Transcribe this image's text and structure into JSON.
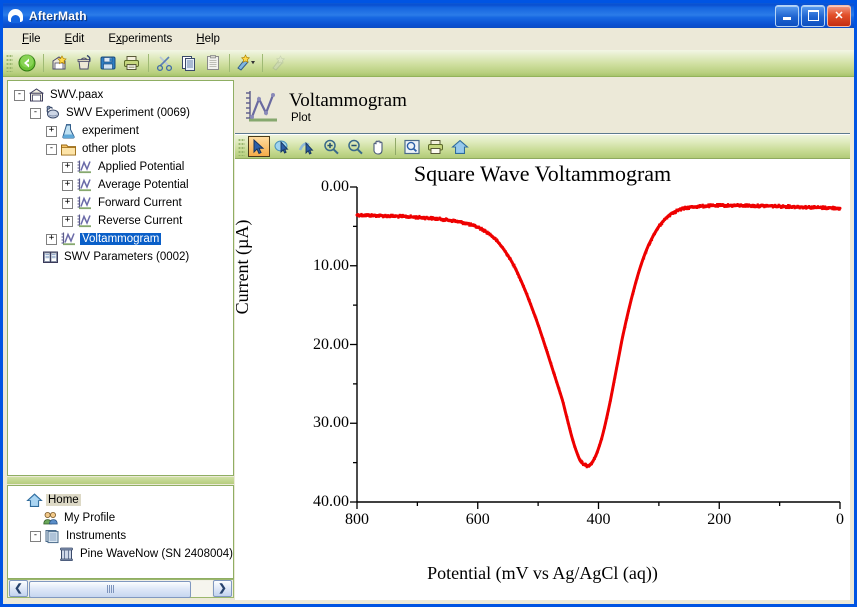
{
  "window": {
    "title": "AfterMath",
    "icon": "aftermath-logo-icon",
    "buttons": {
      "minimize": "–",
      "maximize": "□",
      "close": "✕"
    }
  },
  "menu": {
    "items": [
      {
        "label": "File",
        "pre": "F",
        "rest": "ile"
      },
      {
        "label": "Edit",
        "pre": "E",
        "rest": "dit"
      },
      {
        "label": "Experiments",
        "pre": "E",
        "rest": "xperiments",
        "prefix": "Ex",
        "mnemonic_index": 1
      },
      {
        "label": "Help",
        "pre": "H",
        "rest": "elp"
      }
    ]
  },
  "toolbar": {
    "buttons": [
      {
        "name": "back-button",
        "icon": "green-back-arrow-icon",
        "enabled": true
      },
      {
        "name": "new-archive-button",
        "icon": "archive-new-icon",
        "enabled": true
      },
      {
        "name": "delete-button",
        "icon": "trash-icon",
        "enabled": true
      },
      {
        "name": "save-button",
        "icon": "floppy-disk-icon",
        "enabled": true
      },
      {
        "name": "print-button",
        "icon": "printer-icon",
        "enabled": true
      },
      {
        "name": "cut-button",
        "icon": "scissors-icon",
        "enabled": true
      },
      {
        "name": "copy-button",
        "icon": "copy-pages-icon",
        "enabled": true
      },
      {
        "name": "paste-button",
        "icon": "paste-clipboard-icon",
        "enabled": true
      },
      {
        "name": "new-experiment-button",
        "icon": "wand-sparkle-icon",
        "enabled": true,
        "dropdown": true
      },
      {
        "name": "plot-tool-button",
        "icon": "faded-star-icon",
        "enabled": false
      }
    ]
  },
  "tree": {
    "nodes": [
      {
        "label": "SWV.paax",
        "indent": 0,
        "toggle": "-",
        "icon": "archive-icon"
      },
      {
        "label": "SWV Experiment (0069)",
        "indent": 1,
        "toggle": "-",
        "icon": "experiment-icon"
      },
      {
        "label": "experiment",
        "indent": 2,
        "toggle": "+",
        "icon": "flask-icon"
      },
      {
        "label": "other plots",
        "indent": 2,
        "toggle": "-",
        "icon": "folder-icon"
      },
      {
        "label": "Applied Potential",
        "indent": 3,
        "toggle": "+",
        "icon": "plot-icon"
      },
      {
        "label": "Average Potential",
        "indent": 3,
        "toggle": "+",
        "icon": "plot-icon"
      },
      {
        "label": "Forward Current",
        "indent": 3,
        "toggle": "+",
        "icon": "plot-icon"
      },
      {
        "label": "Reverse Current",
        "indent": 3,
        "toggle": "+",
        "icon": "plot-icon"
      },
      {
        "label": "Voltammogram",
        "indent": 2,
        "toggle": "+",
        "icon": "plot-icon",
        "selected": true
      },
      {
        "label": "SWV Parameters (0002)",
        "indent": 1,
        "toggle": "",
        "icon": "book-icon"
      }
    ]
  },
  "home_tree": {
    "nodes": [
      {
        "label": "Home",
        "indent": 0,
        "toggle": "",
        "icon": "home-icon",
        "highlight": true
      },
      {
        "label": "My Profile",
        "indent": 1,
        "toggle": "",
        "icon": "people-icon"
      },
      {
        "label": "Instruments",
        "indent": 1,
        "toggle": "-",
        "icon": "instruments-icon"
      },
      {
        "label": "Pine WaveNow (SN 2408004)",
        "indent": 2,
        "toggle": "",
        "icon": "device-icon"
      }
    ]
  },
  "scrollbar": {
    "left_arrow": "❮",
    "right_arrow": "❯"
  },
  "plot_pane": {
    "icon": "plot-icon",
    "title": "Voltammogram",
    "subtitle": "Plot",
    "toolbar": [
      {
        "name": "select-tool",
        "icon": "arrow-cursor-icon",
        "active": true
      },
      {
        "name": "data-select-tool",
        "icon": "blue-blob-cursor-icon",
        "active": false
      },
      {
        "name": "trace-select-tool",
        "icon": "trace-cursor-icon",
        "active": false
      },
      {
        "name": "zoom-in-tool",
        "icon": "magnifier-plus-icon",
        "active": false
      },
      {
        "name": "zoom-out-tool",
        "icon": "magnifier-minus-icon",
        "active": false
      },
      {
        "name": "pan-tool",
        "icon": "hand-pan-icon",
        "active": false
      },
      {
        "name": "zoom-fit-tool",
        "icon": "zoom-region-icon",
        "active": false
      },
      {
        "name": "print-plot-tool",
        "icon": "printer-icon",
        "active": false
      },
      {
        "name": "home-view-tool",
        "icon": "home-icon",
        "active": false
      }
    ]
  },
  "chart_data": {
    "type": "line",
    "title": "Square Wave Voltammogram",
    "xlabel": "Potential (mV vs Ag/AgCl (aq))",
    "ylabel": "Current (µA)",
    "xlim": [
      800,
      0
    ],
    "ylim": [
      40.0,
      0.0
    ],
    "y_inverted": true,
    "x_reversed": true,
    "grid": false,
    "legend": null,
    "xticks": [
      800,
      600,
      400,
      200,
      0
    ],
    "xtick_labels": [
      "800",
      "600",
      "400",
      "200",
      "0"
    ],
    "x_minor_step": 100,
    "yticks": [
      0.0,
      10.0,
      20.0,
      30.0,
      40.0
    ],
    "ytick_labels": [
      "0.00",
      "10.00",
      "20.00",
      "30.00",
      "40.00"
    ],
    "y_minor_step": 5,
    "series": [
      {
        "name": "Voltammogram",
        "color": "#ee0000",
        "line_width": 3,
        "x": [
          800,
          780,
          760,
          740,
          720,
          700,
          680,
          660,
          640,
          620,
          600,
          590,
          580,
          570,
          560,
          550,
          540,
          530,
          520,
          510,
          500,
          490,
          480,
          470,
          460,
          455,
          450,
          445,
          440,
          435,
          430,
          425,
          420,
          415,
          410,
          405,
          400,
          395,
          390,
          385,
          380,
          375,
          370,
          365,
          360,
          350,
          340,
          330,
          320,
          310,
          300,
          290,
          280,
          270,
          260,
          250,
          240,
          220,
          200,
          180,
          160,
          140,
          120,
          100,
          80,
          60,
          40,
          20,
          0
        ],
        "y": [
          3.55,
          3.6,
          3.65,
          3.7,
          3.75,
          3.85,
          3.95,
          4.1,
          4.3,
          4.6,
          5.1,
          5.5,
          6.0,
          6.7,
          7.6,
          8.7,
          10.0,
          11.6,
          13.4,
          15.4,
          17.5,
          19.8,
          22.2,
          24.6,
          27.0,
          28.5,
          30.0,
          31.5,
          32.8,
          33.9,
          34.8,
          35.2,
          35.4,
          35.3,
          34.9,
          34.2,
          33.2,
          32.0,
          30.5,
          28.8,
          27.0,
          25.0,
          23.0,
          21.0,
          19.0,
          15.6,
          12.6,
          10.0,
          7.9,
          6.3,
          5.0,
          4.1,
          3.4,
          3.0,
          2.75,
          2.6,
          2.5,
          2.4,
          2.35,
          2.35,
          2.35,
          2.4,
          2.4,
          2.45,
          2.5,
          2.55,
          2.6,
          2.65,
          2.7
        ]
      }
    ]
  }
}
